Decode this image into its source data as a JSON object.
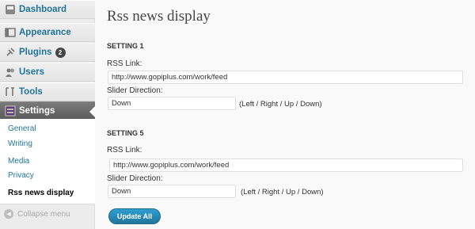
{
  "sidebar": {
    "items": [
      {
        "label": "Dashboard",
        "icon": "dashboard-icon"
      },
      {
        "label": "Appearance",
        "icon": "appearance-icon"
      },
      {
        "label": "Plugins",
        "icon": "plugins-icon",
        "badge": "2"
      },
      {
        "label": "Users",
        "icon": "users-icon"
      },
      {
        "label": "Tools",
        "icon": "tools-icon"
      },
      {
        "label": "Settings",
        "icon": "settings-icon"
      }
    ],
    "submenu": [
      "General",
      "Writing",
      "Media",
      "Privacy",
      "Rss news display"
    ],
    "collapse_label": "Collapse menu"
  },
  "main": {
    "title": "Rss news display",
    "settings": [
      {
        "heading": "SETTING 1",
        "rss_label": "RSS Link:",
        "rss_value": "http://www.gopiplus.com/work/feed",
        "direction_label": "Slider Direction:",
        "direction_value": "Down",
        "direction_hint": "(Left / Right / Up / Down)"
      },
      {
        "heading": "SETTING 5",
        "rss_label": "RSS Link:",
        "rss_value": "http://www.gopiplus.com/work/feed",
        "direction_label": "Slider Direction:",
        "direction_value": "Down",
        "direction_hint": "(Left / Right / Up / Down)"
      }
    ],
    "update_button": "Update All"
  },
  "colors": {
    "link": "#21759b",
    "button": "#21759b",
    "active_menu": "#6b6b6b"
  }
}
